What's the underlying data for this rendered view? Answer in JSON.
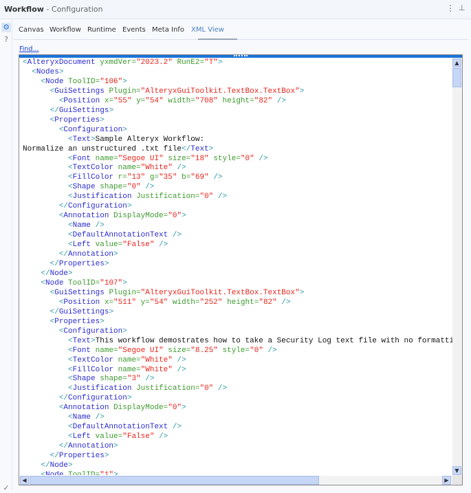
{
  "header": {
    "title": "Workflow",
    "subtitle": "- Configuration",
    "icons": [
      "more-vertical-icon",
      "pin-icon"
    ]
  },
  "sidebar": {
    "icons": [
      "gear-icon",
      "help-icon",
      "check-circle-icon"
    ]
  },
  "tabs": [
    {
      "label": "Canvas"
    },
    {
      "label": "Workflow"
    },
    {
      "label": "Runtime"
    },
    {
      "label": "Events"
    },
    {
      "label": "Meta Info"
    },
    {
      "label": "XML View",
      "active": true
    }
  ],
  "find_label": "Find...",
  "xml_lines": [
    "<AlteryxDocument yxmdVer=\"2023.2\" RunE2=\"T\">",
    "  <Nodes>",
    "    <Node ToolID=\"106\">",
    "      <GuiSettings Plugin=\"AlteryxGuiToolkit.TextBox.TextBox\">",
    "        <Position x=\"55\" y=\"54\" width=\"708\" height=\"82\" />",
    "      </GuiSettings>",
    "      <Properties>",
    "        <Configuration>",
    "          <Text>Sample Alteryx Workflow:",
    "Normalize an unstructured .txt file</Text>",
    "          <Font name=\"Segoe UI\" size=\"18\" style=\"0\" />",
    "          <TextColor name=\"White\" />",
    "          <FillColor r=\"13\" g=\"35\" b=\"69\" />",
    "          <Shape shape=\"0\" />",
    "          <Justification Justification=\"0\" />",
    "        </Configuration>",
    "        <Annotation DisplayMode=\"0\">",
    "          <Name />",
    "          <DefaultAnnotationText />",
    "          <Left value=\"False\" />",
    "        </Annotation>",
    "      </Properties>",
    "    </Node>",
    "    <Node ToolID=\"107\">",
    "      <GuiSettings Plugin=\"AlteryxGuiToolkit.TextBox.TextBox\">",
    "        <Position x=\"511\" y=\"54\" width=\"252\" height=\"82\" />",
    "      </GuiSettings>",
    "      <Properties>",
    "        <Configuration>",
    "          <Text>This workflow demostrates how to take a Security Log text file with no formatting",
    "          <Font name=\"Segoe UI\" size=\"8.25\" style=\"0\" />",
    "          <TextColor name=\"White\" />",
    "          <FillColor name=\"White\" />",
    "          <Shape shape=\"3\" />",
    "          <Justification Justification=\"0\" />",
    "        </Configuration>",
    "        <Annotation DisplayMode=\"0\">",
    "          <Name />",
    "          <DefaultAnnotationText />",
    "          <Left value=\"False\" />",
    "        </Annotation>",
    "      </Properties>",
    "    </Node>",
    "    <Node ToolID=\"1\">"
  ],
  "syntax_colors": {
    "bracket": "#2a9aa6",
    "tag": "#2b2bcf",
    "attribute": "#3d9a2e",
    "value": "#e8241c",
    "text": "#111111",
    "accent": "#1a73d9"
  }
}
